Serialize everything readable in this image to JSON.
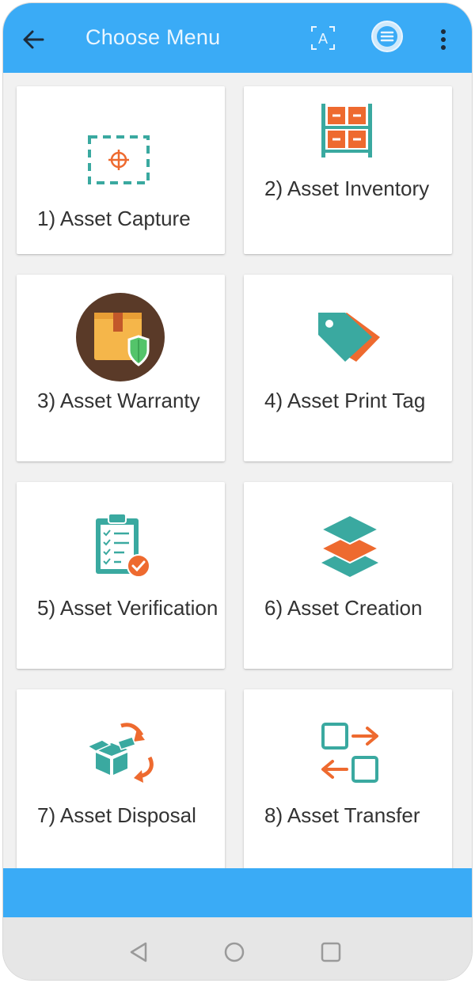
{
  "header": {
    "title": "Choose Menu",
    "ocr_icon_letter": "A"
  },
  "menu": {
    "items": [
      {
        "label": "1) Asset Capture",
        "icon": "capture-frame-icon"
      },
      {
        "label": "2) Asset Inventory",
        "icon": "warehouse-shelf-icon"
      },
      {
        "label": "3) Asset Warranty",
        "icon": "warranty-box-shield-icon"
      },
      {
        "label": "4) Asset Print Tag",
        "icon": "price-tag-icon"
      },
      {
        "label": "5) Asset Verification",
        "icon": "clipboard-check-icon"
      },
      {
        "label": "6) Asset Creation",
        "icon": "layers-icon"
      },
      {
        "label": "7) Asset Disposal",
        "icon": "recycle-box-icon"
      },
      {
        "label": "8) Asset Transfer",
        "icon": "transfer-arrows-icon"
      }
    ]
  },
  "colors": {
    "primary": "#3aabf6",
    "teal": "#3aa9a0",
    "orange": "#ee6a2f"
  }
}
